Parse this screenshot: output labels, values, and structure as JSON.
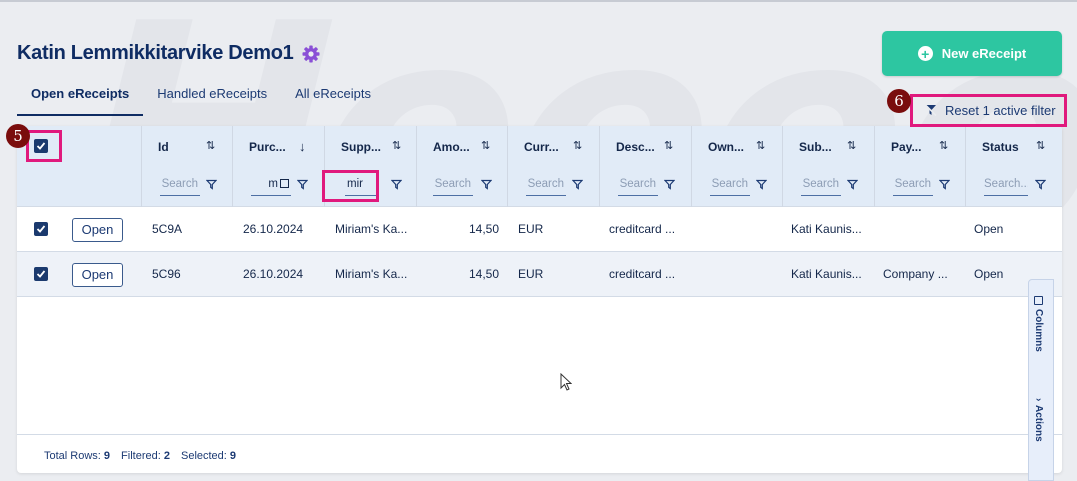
{
  "page": {
    "title": "Katin Lemmikkitarvike Demo1",
    "new_button": "New eReceipt",
    "reset_filter": "Reset 1 active filter"
  },
  "tabs": [
    {
      "label": "Open eReceipts",
      "active": true
    },
    {
      "label": "Handled eReceipts",
      "active": false
    },
    {
      "label": "All eReceipts",
      "active": false
    }
  ],
  "annotations": {
    "badge_left": "5",
    "badge_right": "6"
  },
  "columns": [
    {
      "label": "Id",
      "sort": "⇅",
      "search": "Search"
    },
    {
      "label": "Purc...",
      "sort": "↓",
      "search": "m"
    },
    {
      "label": "Supp...",
      "sort": "⇅",
      "search": "mir"
    },
    {
      "label": "Amo...",
      "sort": "⇅",
      "search": "Search"
    },
    {
      "label": "Curr...",
      "sort": "⇅",
      "search": "Search"
    },
    {
      "label": "Desc...",
      "sort": "⇅",
      "search": "Search"
    },
    {
      "label": "Own...",
      "sort": "⇅",
      "search": "Search"
    },
    {
      "label": "Sub...",
      "sort": "⇅",
      "search": "Search"
    },
    {
      "label": "Pay...",
      "sort": "⇅",
      "search": "Search"
    },
    {
      "label": "Status",
      "sort": "⇅",
      "search": "Search..."
    }
  ],
  "rows": [
    {
      "open": "Open",
      "id": "5C9A",
      "date": "26.10.2024",
      "supplier": "Miriam's Ka...",
      "amount": "14,50",
      "currency": "EUR",
      "description": "creditcard ...",
      "owner": "",
      "submitter": "Kati Kaunis...",
      "payment": "",
      "status": "Open"
    },
    {
      "open": "Open",
      "id": "5C96",
      "date": "26.10.2024",
      "supplier": "Miriam's Ka...",
      "amount": "14,50",
      "currency": "EUR",
      "description": "creditcard ...",
      "owner": "",
      "submitter": "Kati Kaunis...",
      "payment": "Company ...",
      "status": "Open"
    }
  ],
  "footer": {
    "total_label": "Total Rows:",
    "total": "9",
    "filtered_label": "Filtered:",
    "filtered": "2",
    "selected_label": "Selected:",
    "selected": "9"
  },
  "side_panel": {
    "columns": "Columns",
    "actions": "Actions"
  },
  "colors": {
    "accent": "#2dc6a1",
    "primary": "#0f2c63",
    "highlight": "#e0197d",
    "badge": "#7a0d0d",
    "gear": "#8a4fd6"
  }
}
